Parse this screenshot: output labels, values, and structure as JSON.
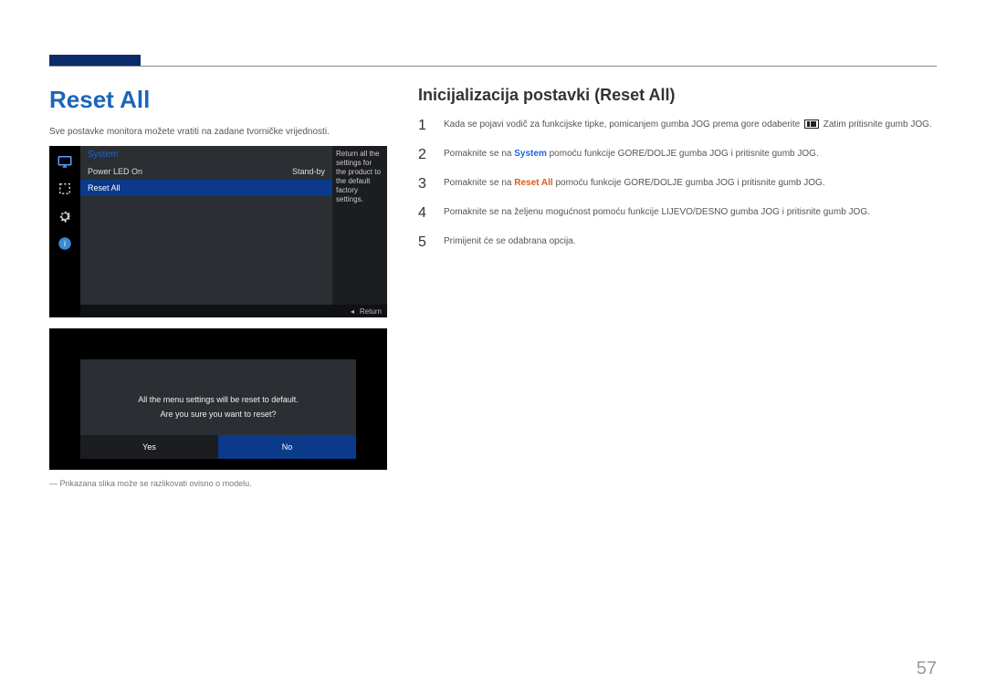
{
  "page": {
    "number": "57",
    "title": "Reset All",
    "subtitle": "Sve postavke monitora možete vratiti na zadane tvorničke vrijednosti.",
    "note": "― Prikazana slika može se razlikovati ovisno o modelu."
  },
  "osd": {
    "header": "System",
    "rows": [
      {
        "label": "Power LED On",
        "value": "Stand-by",
        "selected": false
      },
      {
        "label": "Reset All",
        "value": "",
        "selected": true
      }
    ],
    "description": "Return all the settings for the product to the default factory settings.",
    "footer_symbol": "◂",
    "footer_label": "Return",
    "icons": [
      "monitor",
      "square-target",
      "gear",
      "info"
    ]
  },
  "dialog": {
    "line1": "All the menu settings will be reset to default.",
    "line2": "Are you sure you want to reset?",
    "yes": "Yes",
    "no": "No"
  },
  "right": {
    "heading": "Inicijalizacija postavki (Reset All)",
    "steps": [
      {
        "n": "1",
        "pre": "Kada se pojavi vodič za funkcijske tipke, pomicanjem gumba JOG prema gore odaberite ",
        "icon": true,
        "post": "  Zatim pritisnite gumb JOG."
      },
      {
        "n": "2",
        "pre": "Pomaknite se na ",
        "hl": "System",
        "hl_class": "hl-blue",
        "post": " pomoću funkcije GORE/DOLJE gumba JOG i pritisnite gumb JOG."
      },
      {
        "n": "3",
        "pre": "Pomaknite se na ",
        "hl": "Reset All",
        "hl_class": "hl-orange",
        "post": " pomoću funkcije GORE/DOLJE gumba JOG i pritisnite gumb JOG."
      },
      {
        "n": "4",
        "pre": "Pomaknite se na željenu mogućnost pomoću funkcije LIJEVO/DESNO gumba JOG i pritisnite gumb JOG.",
        "post": ""
      },
      {
        "n": "5",
        "pre": "Primijenit će se odabrana opcija.",
        "post": ""
      }
    ]
  }
}
